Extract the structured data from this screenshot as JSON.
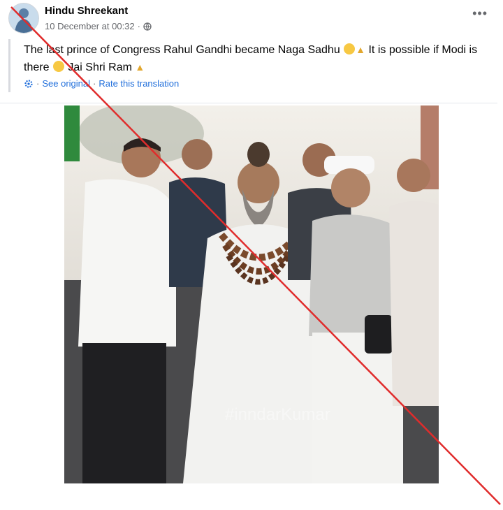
{
  "post": {
    "author": "Hindu Shreekant",
    "timestamp": "10 December at 00:32",
    "visibility_icon": "globe-icon",
    "menu_icon": "more-options-icon",
    "text_part1": "The last prince of Congress Rahul Gandhi became Naga Sadhu",
    "text_part2": "It is possible if Modi is there",
    "text_part3": "Jai Shri Ram",
    "see_original": "See original",
    "rate_translation": "Rate this translation",
    "watermark": "#inndarKumar"
  },
  "colors": {
    "link": "#216fdb",
    "meta": "#65676b",
    "cross_line": "#e02c2c"
  }
}
